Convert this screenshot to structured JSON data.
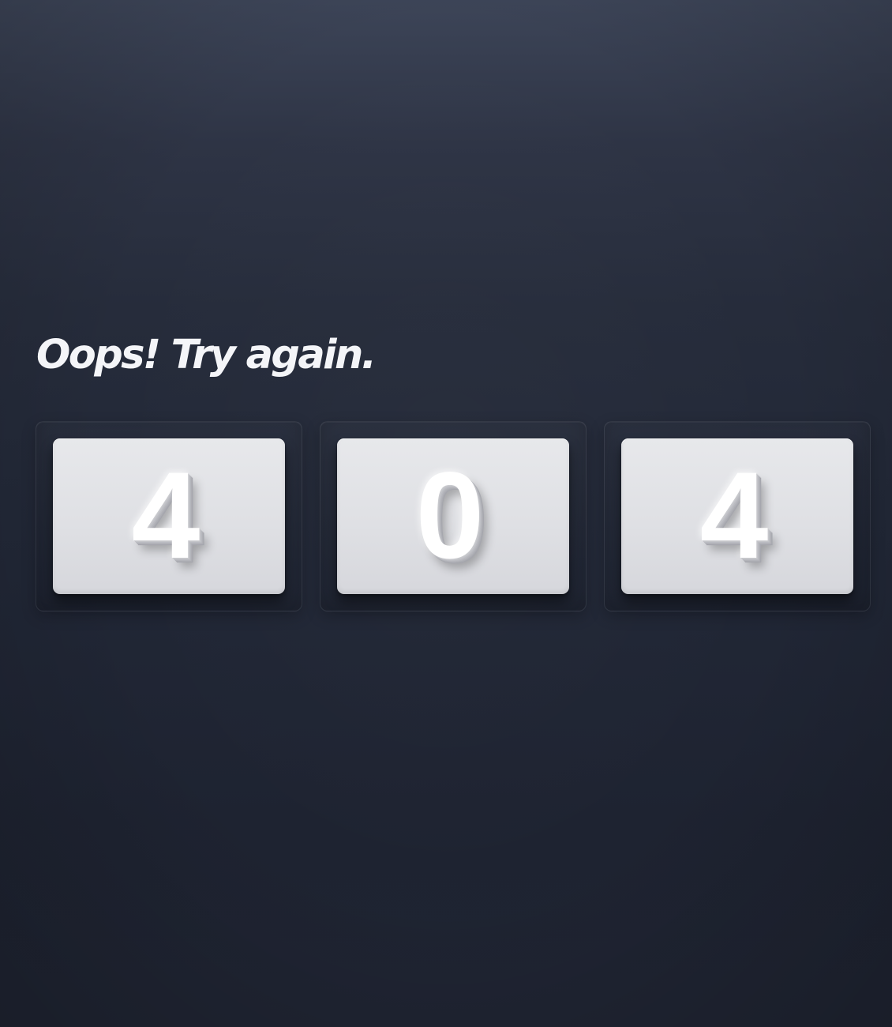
{
  "page": {
    "headline": "Oops! Try again.",
    "digits": [
      "4",
      "0",
      "4"
    ]
  },
  "colors": {
    "background_top": "#3d4558",
    "background_bottom": "#1f2432",
    "headline": "#f4f5f8",
    "tile": "#e0e1e5",
    "digit": "#ffffff"
  }
}
